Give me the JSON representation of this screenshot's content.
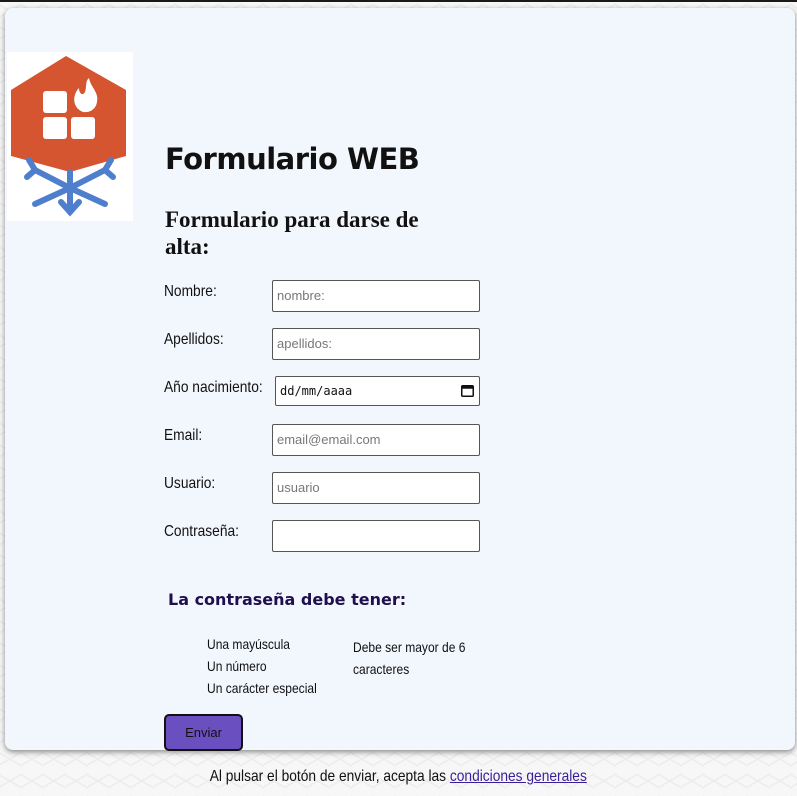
{
  "header": {
    "title": "Formulario WEB",
    "subtitle": "Formulario para darse de alta:"
  },
  "logo": {
    "icon": "house-fire-snowflake-logo",
    "colors": {
      "house": "#d4552f",
      "snowflake": "#4f7ecc"
    }
  },
  "form": {
    "fields": [
      {
        "label": "Nombre:",
        "placeholder": "nombre:"
      },
      {
        "label": "Apellidos:",
        "placeholder": "apellidos:"
      },
      {
        "label": "Año nacimiento:",
        "value": "dd/mm/aaaa"
      },
      {
        "label": "Email:",
        "placeholder": "email@email.com"
      },
      {
        "label": "Usuario:",
        "placeholder": "usuario"
      },
      {
        "label": "Contraseña:",
        "placeholder": ""
      }
    ],
    "submit_label": "Enviar"
  },
  "password_rules": {
    "heading": "La contraseña debe tener:",
    "items": [
      "Una mayúscula",
      "Un número",
      "Un carácter especial",
      "Debe ser mayor de 6 caracteres"
    ]
  },
  "footer": {
    "text": "Al pulsar el botón de enviar, acepta las",
    "link": "condiciones generales"
  },
  "colors": {
    "card_background": "#f2f6fd",
    "button": "#6a4fc0",
    "heading_accent": "#1f0f4f"
  }
}
